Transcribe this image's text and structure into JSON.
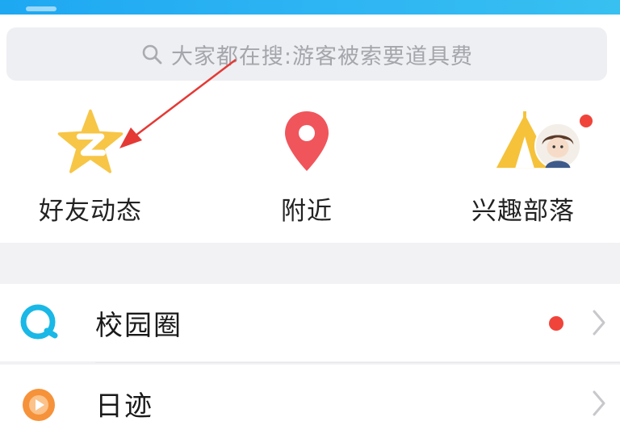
{
  "search": {
    "placeholder": "大家都在搜:游客被索要道具费"
  },
  "quick_entries": [
    {
      "label": "好友动态",
      "icon": "qzone-star-icon",
      "color": "#f7c646"
    },
    {
      "label": "附近",
      "icon": "location-pin-icon",
      "color": "#f0555b"
    },
    {
      "label": "兴趣部落",
      "icon": "tent-icon",
      "color": "#f5c23a",
      "badge": true
    }
  ],
  "list": [
    {
      "label": "校园圈",
      "icon": "campus-circle-icon",
      "color": "#19b8e6",
      "badge": true
    },
    {
      "label": "日迹",
      "icon": "daily-trace-icon",
      "color": "#f6923a",
      "badge": false
    }
  ],
  "colors": {
    "accent": "#1ea8f2",
    "badge": "#f0443a",
    "annotation": "#e53935"
  }
}
